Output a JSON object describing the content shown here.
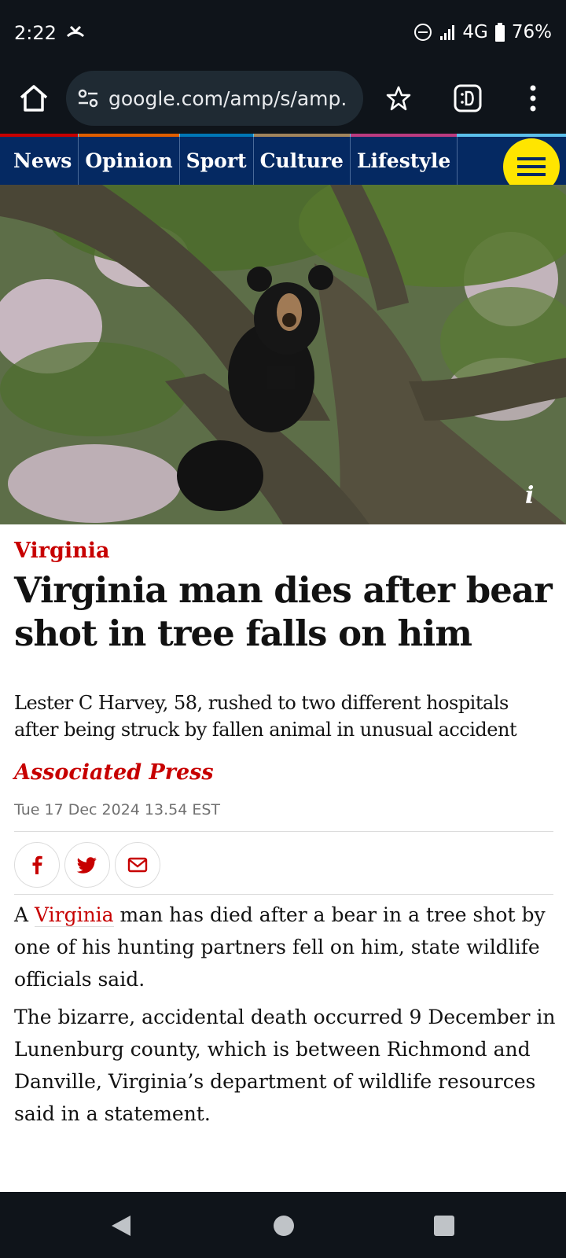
{
  "status_bar": {
    "time": "2:22",
    "network": "4G",
    "battery": "76%",
    "icons": [
      "missed-call-icon",
      "do-not-disturb-icon",
      "signal-icon",
      "battery-icon"
    ]
  },
  "browser": {
    "url": "google.com/amp/s/amp.",
    "icons": [
      "home-icon",
      "site-settings-icon",
      "star-icon",
      "tab-switcher-icon",
      "more-vert-icon"
    ]
  },
  "nav": {
    "items": [
      {
        "label": "News",
        "accent": "#c70000"
      },
      {
        "label": "Opinion",
        "accent": "#e05e00"
      },
      {
        "label": "Sport",
        "accent": "#0077b6"
      },
      {
        "label": "Culture",
        "accent": "#a1845c"
      },
      {
        "label": "Lifestyle",
        "accent": "#bb3b80"
      }
    ],
    "background": "#052962",
    "menu_button_color": "#ffe500"
  },
  "hero": {
    "info_label": "i"
  },
  "article": {
    "kicker": "Virginia",
    "headline": "Virginia man dies after bear shot in tree falls on him",
    "standfirst": "Lester C Harvey, 58, rushed to two different hospitals after being struck by fallen animal in unusual accident",
    "byline": "Associated Press",
    "date": "Tue 17 Dec 2024 13.54 EST",
    "share_icons": [
      "facebook-icon",
      "twitter-icon",
      "email-icon"
    ],
    "p1_before": "A ",
    "p1_link": "Virginia",
    "p1_after": " man has died after a bear in a tree shot by one of his hunting partners fell on him, state wildlife officials said.",
    "p2": "The bizarre, accidental death occurred 9 December in Lunenburg county, which is between Richmond and Danville, Virginia’s department of wildlife resources said in a statement.",
    "accent_color": "#c70000"
  },
  "system_nav": {
    "icons": [
      "back-icon",
      "home-circle-icon",
      "recents-icon"
    ]
  }
}
